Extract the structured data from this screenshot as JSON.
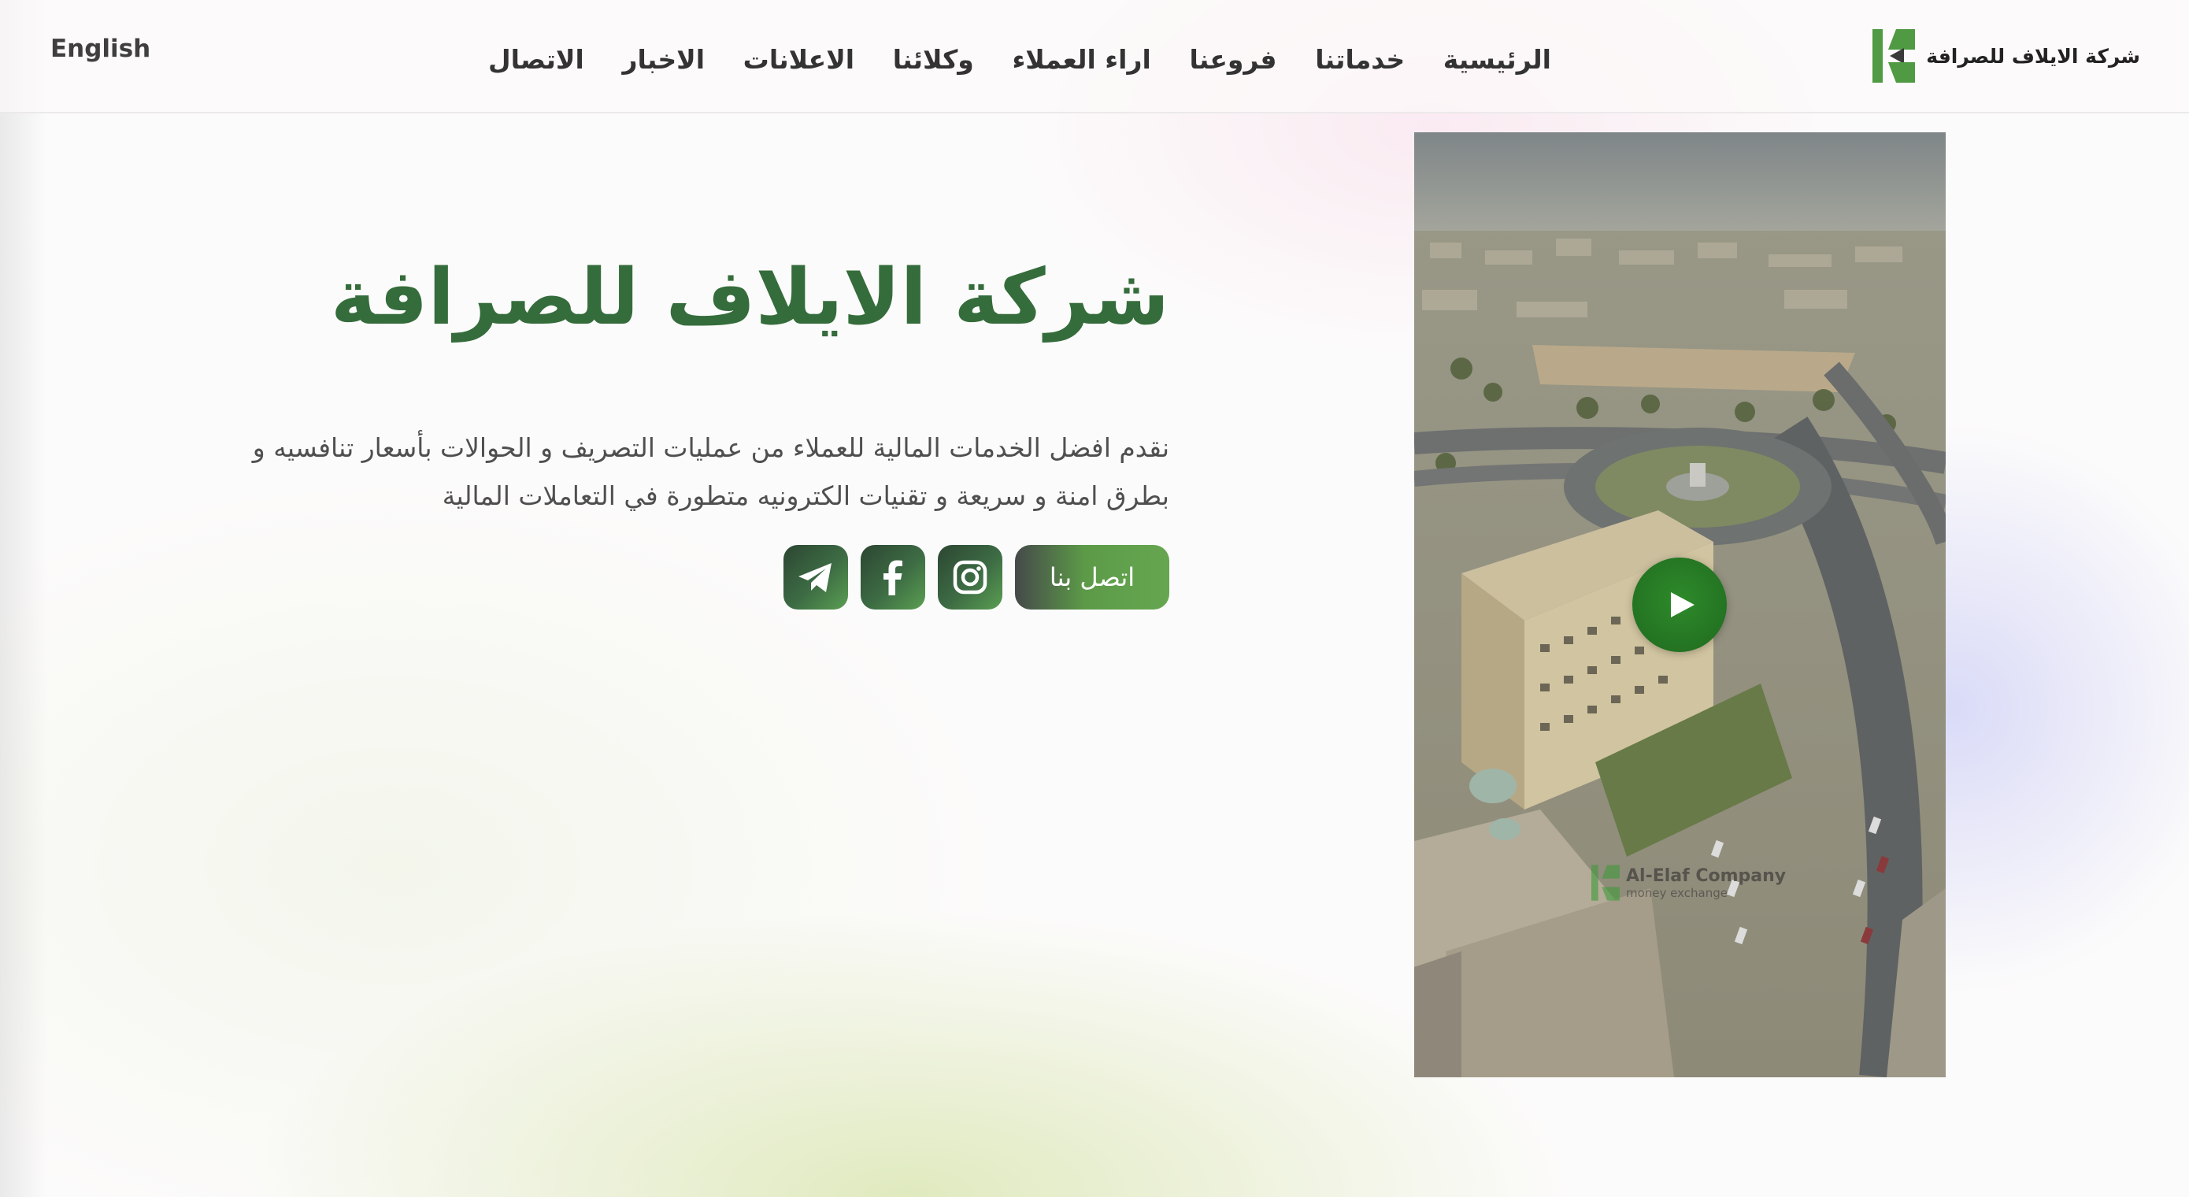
{
  "header": {
    "language_toggle": "English",
    "brand_name": "شركة الايلاف للصرافة",
    "nav": [
      {
        "label": "الرئيسية"
      },
      {
        "label": "خدماتنا"
      },
      {
        "label": "فروعنا"
      },
      {
        "label": "اراء العملاء"
      },
      {
        "label": "وكلائنا"
      },
      {
        "label": "الاعلانات"
      },
      {
        "label": "الاخبار"
      },
      {
        "label": "الاتصال"
      }
    ]
  },
  "hero": {
    "title": "شركة الايلاف للصرافة",
    "description_line1": "نقدم افضل الخدمات المالية للعملاء من عمليات التصريف و الحوالات بأسعار تنافسيه و",
    "description_line2": "بطرق امنة و سريعة و تقنيات الكترونيه متطورة في التعاملات المالية",
    "contact_label": "اتصل بنا",
    "social": [
      "instagram-icon",
      "facebook-icon",
      "telegram-icon"
    ]
  },
  "video": {
    "watermark_title": "Al-Elaf Company",
    "watermark_subtitle": "money exchange"
  },
  "colors": {
    "brand_green": "#356c3b",
    "accent_green": "#5c9a48",
    "logo_green": "#4f9a42"
  }
}
